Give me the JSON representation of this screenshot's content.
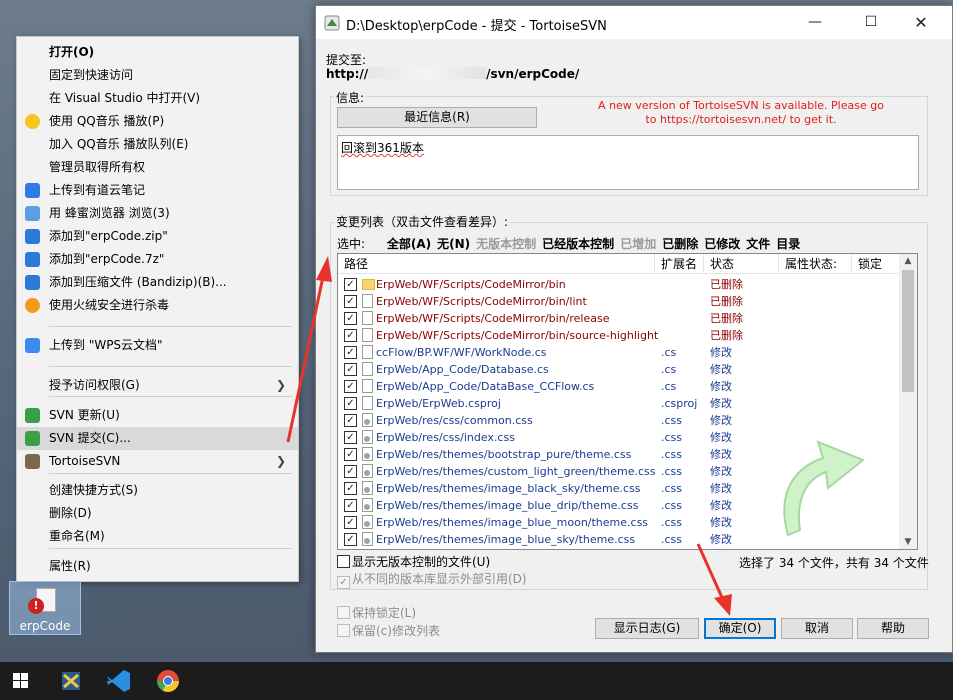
{
  "context_menu": {
    "items": [
      {
        "label": "打开(O)",
        "bold": true
      },
      {
        "label": "固定到快速访问"
      },
      {
        "label": "在 Visual Studio 中打开(V)"
      },
      {
        "label": "使用 QQ音乐 播放(P)",
        "icon": "qqmusic-icon"
      },
      {
        "label": "加入 QQ音乐 播放队列(E)"
      },
      {
        "label": "管理员取得所有权"
      },
      {
        "label": "上传到有道云笔记",
        "icon": "youdao-note-icon"
      },
      {
        "label": "用 蜂蜜浏览器 浏览(3)",
        "icon": "honey-browser-icon"
      },
      {
        "label": "添加到\"erpCode.zip\"",
        "icon": "bandizip-icon"
      },
      {
        "label": "添加到\"erpCode.7z\"",
        "icon": "bandizip-icon"
      },
      {
        "label": "添加到压缩文件 (Bandizip)(B)...",
        "icon": "bandizip-icon"
      },
      {
        "label": "使用火绒安全进行杀毒",
        "icon": "huorong-icon"
      },
      {
        "label": "上传到 \"WPS云文档\"",
        "icon": "wps-cloud-icon"
      },
      {
        "label": "授予访问权限(G)",
        "submenu": true
      },
      {
        "label": "SVN 更新(U)",
        "icon": "svn-update-icon"
      },
      {
        "label": "SVN 提交(C)...",
        "icon": "svn-commit-icon",
        "highlighted": true
      },
      {
        "label": "TortoiseSVN",
        "icon": "tortoisesvn-icon",
        "submenu": true
      },
      {
        "label": "创建快捷方式(S)"
      },
      {
        "label": "删除(D)"
      },
      {
        "label": "重命名(M)"
      },
      {
        "label": "属性(R)"
      }
    ]
  },
  "desktop_icon": {
    "label": "erpCode"
  },
  "dialog": {
    "title": "D:\\Desktop\\erpCode - 提交 - TortoiseSVN",
    "commit_to_label": "提交至:",
    "commit_url_prefix": "http://",
    "commit_url_suffix": "/svn/erpCode/",
    "message_group_label": "信息:",
    "recent_messages_button": "最近信息(R)",
    "update_notice": "A new version of TortoiseSVN is available. Please go to https://tortoisesvn.net/ to get it.",
    "message_text": "回滚到361版本",
    "changes_group_label": "变更列表（双击文件查看差异）:",
    "filter": {
      "label": "选中:",
      "options": [
        {
          "label": "全部(A)",
          "style": "b"
        },
        {
          "label": "无(N)",
          "style": "b"
        },
        {
          "label": "无版本控制",
          "style": "g"
        },
        {
          "label": "已经版本控制",
          "style": "b"
        },
        {
          "label": "已增加",
          "style": "g"
        },
        {
          "label": "已删除",
          "style": "b"
        },
        {
          "label": "已修改",
          "style": "b"
        },
        {
          "label": "文件",
          "style": "b"
        },
        {
          "label": "目录",
          "style": "b"
        }
      ]
    },
    "columns": [
      "路径",
      "扩展名",
      "状态",
      "属性状态:",
      "锁定"
    ],
    "files": [
      {
        "path": "ErpWeb/WF/Scripts/CodeMirror/bin",
        "ext": "",
        "status": "已删除",
        "kind": "folder"
      },
      {
        "path": "ErpWeb/WF/Scripts/CodeMirror/bin/lint",
        "ext": "",
        "status": "已删除",
        "kind": "file"
      },
      {
        "path": "ErpWeb/WF/Scripts/CodeMirror/bin/release",
        "ext": "",
        "status": "已删除",
        "kind": "file"
      },
      {
        "path": "ErpWeb/WF/Scripts/CodeMirror/bin/source-highlight",
        "ext": "",
        "status": "已删除",
        "kind": "file"
      },
      {
        "path": "ccFlow/BP.WF/WF/WorkNode.cs",
        "ext": ".cs",
        "status": "修改",
        "kind": "file"
      },
      {
        "path": "ErpWeb/App_Code/Database.cs",
        "ext": ".cs",
        "status": "修改",
        "kind": "file"
      },
      {
        "path": "ErpWeb/App_Code/DataBase_CCFlow.cs",
        "ext": ".cs",
        "status": "修改",
        "kind": "file"
      },
      {
        "path": "ErpWeb/ErpWeb.csproj",
        "ext": ".csproj",
        "status": "修改",
        "kind": "file"
      },
      {
        "path": "ErpWeb/res/css/common.css",
        "ext": ".css",
        "status": "修改",
        "kind": "css"
      },
      {
        "path": "ErpWeb/res/css/index.css",
        "ext": ".css",
        "status": "修改",
        "kind": "css"
      },
      {
        "path": "ErpWeb/res/themes/bootstrap_pure/theme.css",
        "ext": ".css",
        "status": "修改",
        "kind": "css"
      },
      {
        "path": "ErpWeb/res/themes/custom_light_green/theme.css",
        "ext": ".css",
        "status": "修改",
        "kind": "css"
      },
      {
        "path": "ErpWeb/res/themes/image_black_sky/theme.css",
        "ext": ".css",
        "status": "修改",
        "kind": "css"
      },
      {
        "path": "ErpWeb/res/themes/image_blue_drip/theme.css",
        "ext": ".css",
        "status": "修改",
        "kind": "css"
      },
      {
        "path": "ErpWeb/res/themes/image_blue_moon/theme.css",
        "ext": ".css",
        "status": "修改",
        "kind": "css"
      },
      {
        "path": "ErpWeb/res/themes/image_blue_sky/theme.css",
        "ext": ".css",
        "status": "修改",
        "kind": "css"
      }
    ],
    "show_unversioned_label": "显示无版本控制的文件(U)",
    "show_externals_label": "从不同的版本库显示外部引用(D)",
    "selection_summary": "选择了 34 个文件，共有 34 个文件",
    "keep_locks_label": "保持锁定(L)",
    "keep_changelists_label": "保留(c)修改列表",
    "buttons": {
      "show_log": "显示日志(G)",
      "ok": "确定(O)",
      "cancel": "取消",
      "help": "帮助"
    }
  },
  "colors": {
    "deleted": "#8b0000",
    "modified": "#1a3d8f",
    "annotation_arrow": "#e8322a",
    "notice": "#e0201a"
  }
}
